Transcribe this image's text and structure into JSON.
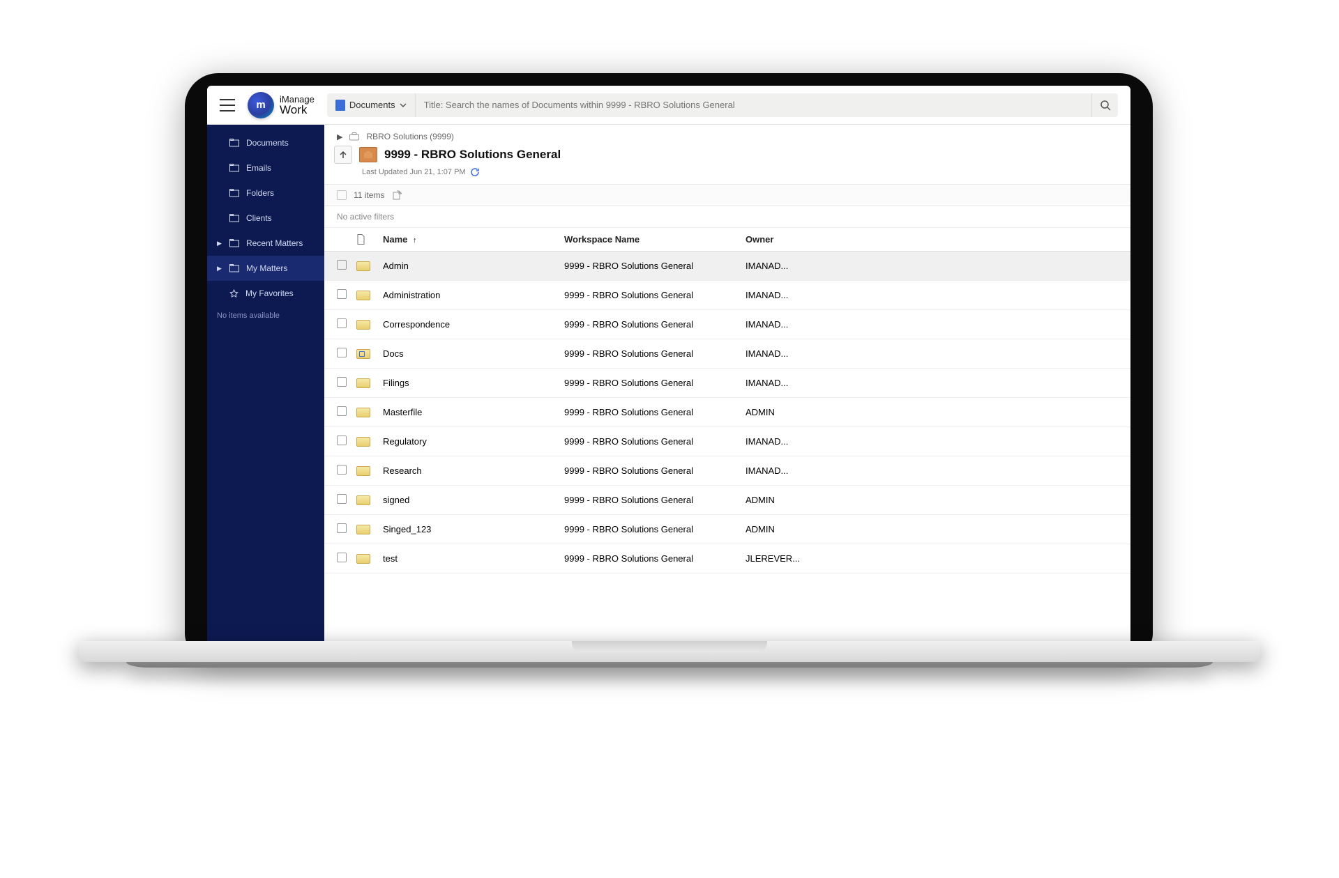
{
  "logo": {
    "line1": "iManage",
    "line2": "Work",
    "mark": "m"
  },
  "search": {
    "selector": "Documents",
    "placeholder": "Title: Search the names of Documents within 9999 - RBRO Solutions General"
  },
  "sidebar": {
    "items": [
      {
        "label": "Documents",
        "caret": false
      },
      {
        "label": "Emails",
        "caret": false
      },
      {
        "label": "Folders",
        "caret": false
      },
      {
        "label": "Clients",
        "caret": false
      },
      {
        "label": "Recent Matters",
        "caret": true
      },
      {
        "label": "My Matters",
        "caret": true,
        "active": true
      },
      {
        "label": "My Favorites",
        "caret": false,
        "icon": "star"
      }
    ],
    "empty": "No items available"
  },
  "breadcrumb": {
    "client": "RBRO Solutions (9999)"
  },
  "workspace": {
    "title": "9999 - RBRO Solutions General",
    "updated": "Last Updated Jun 21, 1:07 PM"
  },
  "toolbar": {
    "count": "11 items"
  },
  "filters": "No active filters",
  "columns": {
    "name": "Name",
    "workspace": "Workspace Name",
    "owner": "Owner"
  },
  "rows": [
    {
      "name": "Admin",
      "workspace": "9999 - RBRO Solutions General",
      "owner": "IMANAD..."
    },
    {
      "name": "Administration",
      "workspace": "9999 - RBRO Solutions General",
      "owner": "IMANAD..."
    },
    {
      "name": "Correspondence",
      "workspace": "9999 - RBRO Solutions General",
      "owner": "IMANAD..."
    },
    {
      "name": "Docs",
      "workspace": "9999 - RBRO Solutions General",
      "owner": "IMANAD...",
      "special": true
    },
    {
      "name": "Filings",
      "workspace": "9999 - RBRO Solutions General",
      "owner": "IMANAD..."
    },
    {
      "name": "Masterfile",
      "workspace": "9999 - RBRO Solutions General",
      "owner": "ADMIN"
    },
    {
      "name": "Regulatory",
      "workspace": "9999 - RBRO Solutions General",
      "owner": "IMANAD..."
    },
    {
      "name": "Research",
      "workspace": "9999 - RBRO Solutions General",
      "owner": "IMANAD..."
    },
    {
      "name": "signed",
      "workspace": "9999 - RBRO Solutions General",
      "owner": "ADMIN"
    },
    {
      "name": "Singed_123",
      "workspace": "9999 - RBRO Solutions General",
      "owner": "ADMIN"
    },
    {
      "name": "test",
      "workspace": "9999 - RBRO Solutions General",
      "owner": "JLEREVER..."
    }
  ]
}
